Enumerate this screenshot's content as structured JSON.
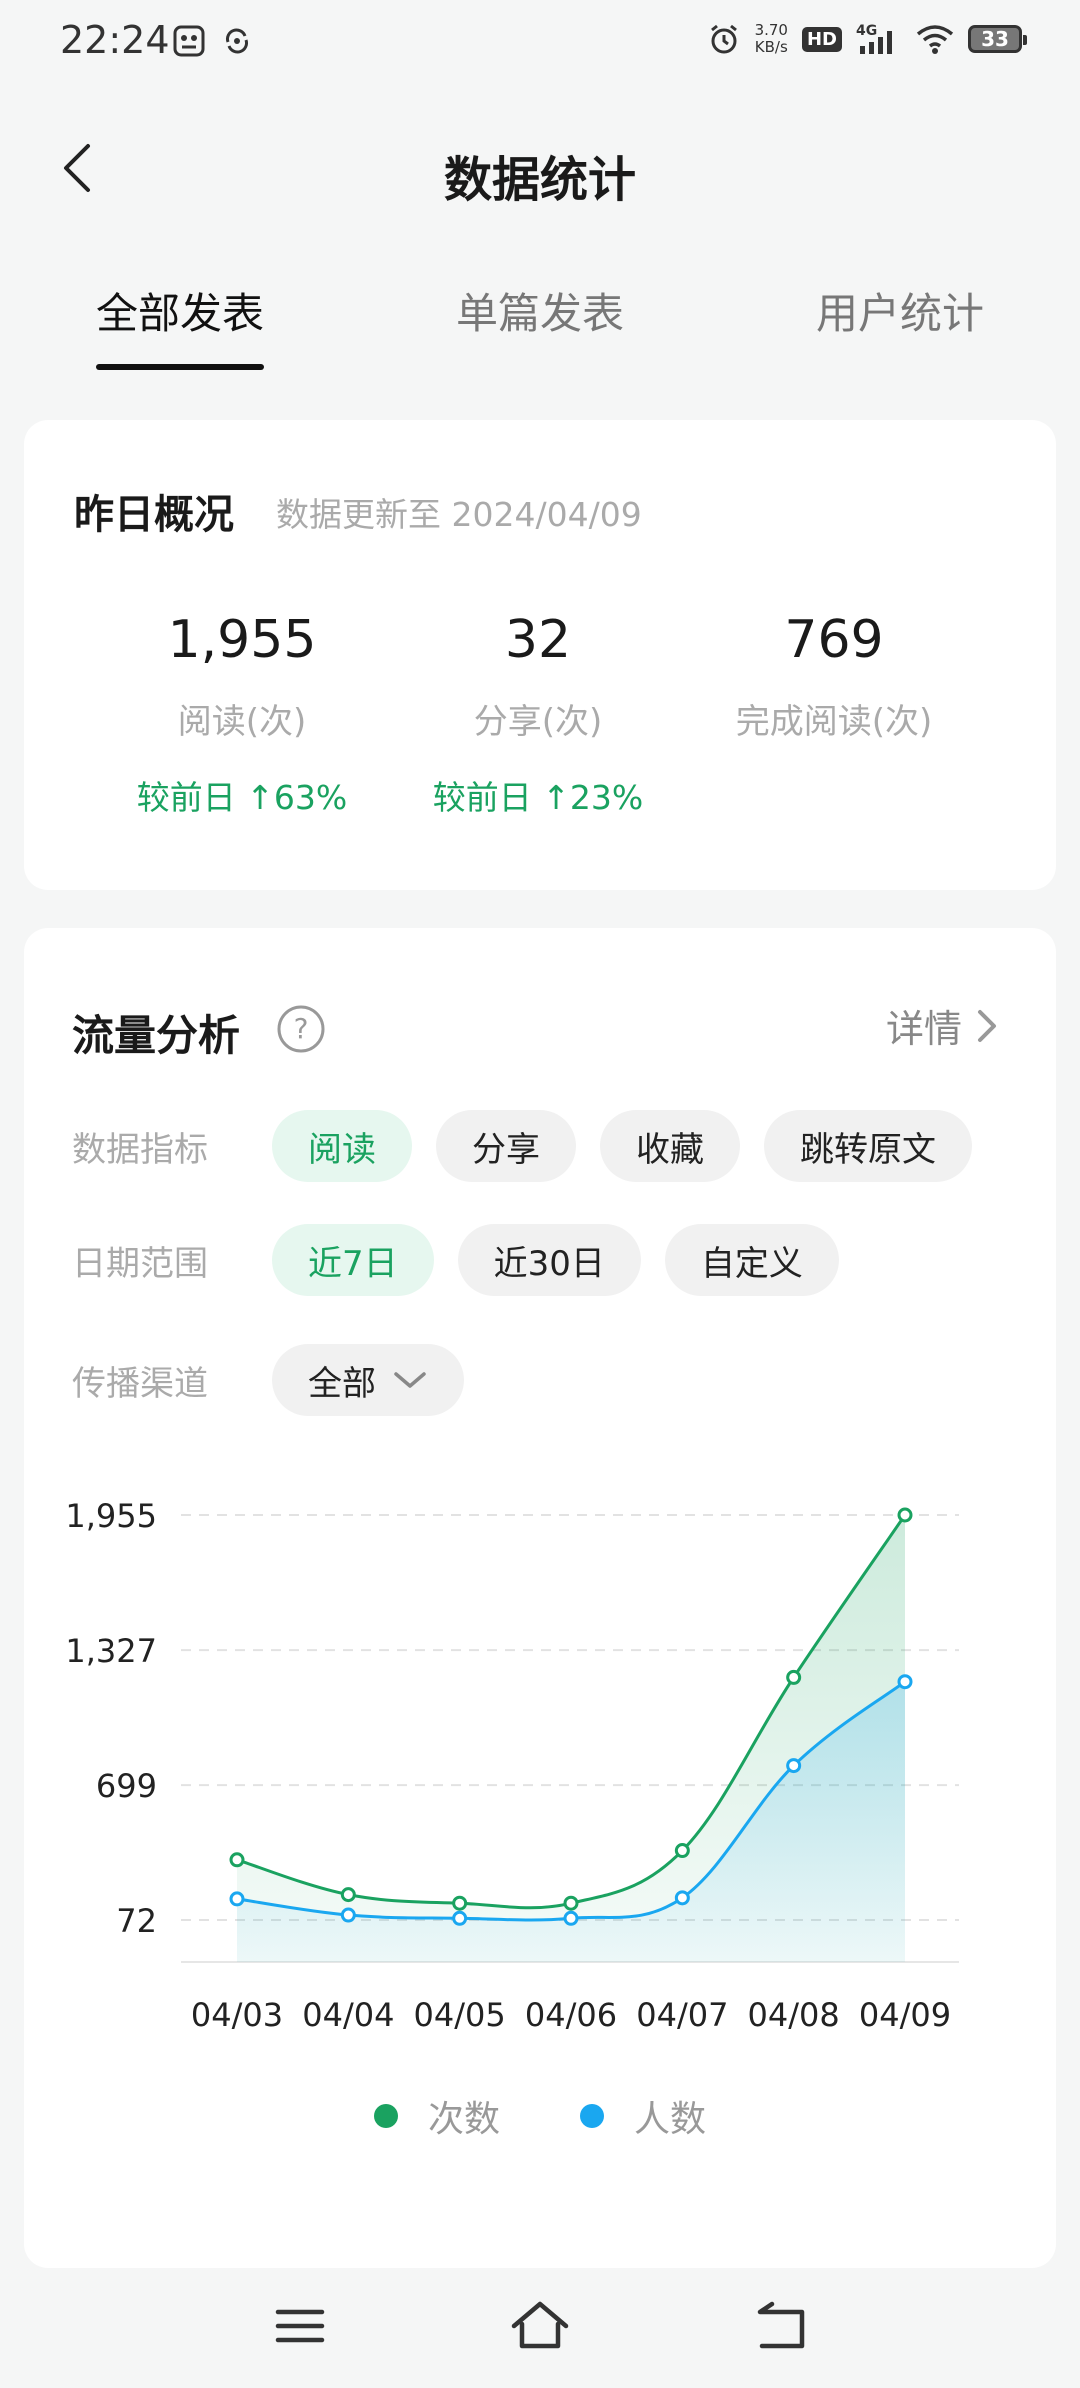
{
  "status": {
    "time": "22:24",
    "net_speed_value": "3.70",
    "net_speed_unit": "KB/s",
    "hd": "HD",
    "signal_label": "4G",
    "battery": "33"
  },
  "header": {
    "title": "数据统计"
  },
  "tabs": [
    {
      "label": "全部发表",
      "active": true
    },
    {
      "label": "单篇发表",
      "active": false
    },
    {
      "label": "用户统计",
      "active": false
    }
  ],
  "overview": {
    "title": "昨日概况",
    "subtitle": "数据更新至 2024/04/09",
    "stats": [
      {
        "value": "1,955",
        "label": "阅读(次)",
        "change": "较前日 ↑63%"
      },
      {
        "value": "32",
        "label": "分享(次)",
        "change": "较前日 ↑23%"
      },
      {
        "value": "769",
        "label": "完成阅读(次)",
        "change": ""
      }
    ]
  },
  "traffic": {
    "title": "流量分析",
    "detail_label": "详情",
    "metric_label": "数据指标",
    "metrics": [
      "阅读",
      "分享",
      "收藏",
      "跳转原文"
    ],
    "range_label": "日期范围",
    "ranges": [
      "近7日",
      "近30日",
      "自定义"
    ],
    "channel_label": "传播渠道",
    "channel_value": "全部"
  },
  "colors": {
    "accent": "#1aa260",
    "secondary": "#1aa7f0"
  },
  "chart_data": {
    "type": "area",
    "categories": [
      "04/03",
      "04/04",
      "04/05",
      "04/06",
      "04/07",
      "04/08",
      "04/09"
    ],
    "yticks": [
      "1,955",
      "1,327",
      "699",
      "72"
    ],
    "ylim": [
      72,
      1955
    ],
    "series": [
      {
        "name": "次数",
        "color": "#1aa260",
        "values": [
          352,
          190,
          150,
          150,
          395,
          1200,
          1955
        ]
      },
      {
        "name": "人数",
        "color": "#1aa7f0",
        "values": [
          170,
          95,
          80,
          80,
          175,
          790,
          1180
        ]
      }
    ],
    "grid": true,
    "legend": "bottom"
  }
}
